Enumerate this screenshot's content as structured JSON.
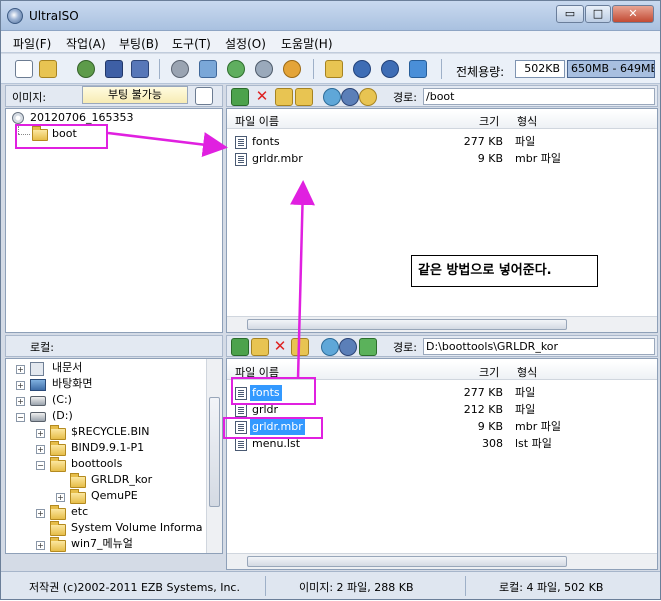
{
  "window": {
    "title": "UltraISO",
    "minimize": "▭",
    "maximize": "□",
    "close": "✕"
  },
  "menu": [
    "파일(F)",
    "작업(A)",
    "부팅(B)",
    "도구(T)",
    "설정(O)",
    "도움말(H)"
  ],
  "toolbar": {
    "total_size_label": "전체용량:",
    "total_size_value": "502KB",
    "capacity_value": "650MB - 649MB"
  },
  "image_panel": {
    "label": "이미지:",
    "boot_status": "부팅 불가능",
    "path_label": "경로:",
    "path_value": "/boot",
    "tree": [
      {
        "label": "20120706_165353",
        "kind": "cd"
      },
      {
        "label": "boot",
        "kind": "folder"
      }
    ],
    "columns": {
      "name": "파일 이름",
      "size": "크기",
      "type": "형식"
    },
    "files": [
      {
        "name": "fonts",
        "size": "277 KB",
        "type": "파일"
      },
      {
        "name": "grldr.mbr",
        "size": "9 KB",
        "type": "mbr 파일"
      }
    ]
  },
  "local_panel": {
    "label": "로컬:",
    "path_label": "경로:",
    "path_value": "D:\\boottools\\GRLDR_kor",
    "tree": [
      {
        "label": "내문서"
      },
      {
        "label": "바탕화면"
      },
      {
        "label": "(C:)"
      },
      {
        "label": "(D:)"
      },
      {
        "label": "$RECYCLE.BIN"
      },
      {
        "label": "BIND9.9.1-P1"
      },
      {
        "label": "boottools"
      },
      {
        "label": "GRLDR_kor"
      },
      {
        "label": "QemuPE"
      },
      {
        "label": "etc"
      },
      {
        "label": "System Volume Informa"
      },
      {
        "label": "win7_메뉴얼"
      }
    ],
    "columns": {
      "name": "파일 이름",
      "size": "크기",
      "type": "형식"
    },
    "files": [
      {
        "name": "fonts",
        "size": "277 KB",
        "type": "파일"
      },
      {
        "name": "grldr",
        "size": "212 KB",
        "type": "파일"
      },
      {
        "name": "grldr.mbr",
        "size": "9 KB",
        "type": "mbr 파일"
      },
      {
        "name": "menu.lst",
        "size": "308",
        "type": "lst 파일"
      }
    ]
  },
  "callout": "같은 방법으로 넣어준다.",
  "status": {
    "copyright": "저작권 (c)2002-2011 EZB Systems, Inc.",
    "image_info": "이미지: 2 파일, 288 KB",
    "local_info": "로컬: 4 파일, 502 KB"
  },
  "colors": {
    "annotation": "#e020e0",
    "selection": "#3399ff"
  }
}
